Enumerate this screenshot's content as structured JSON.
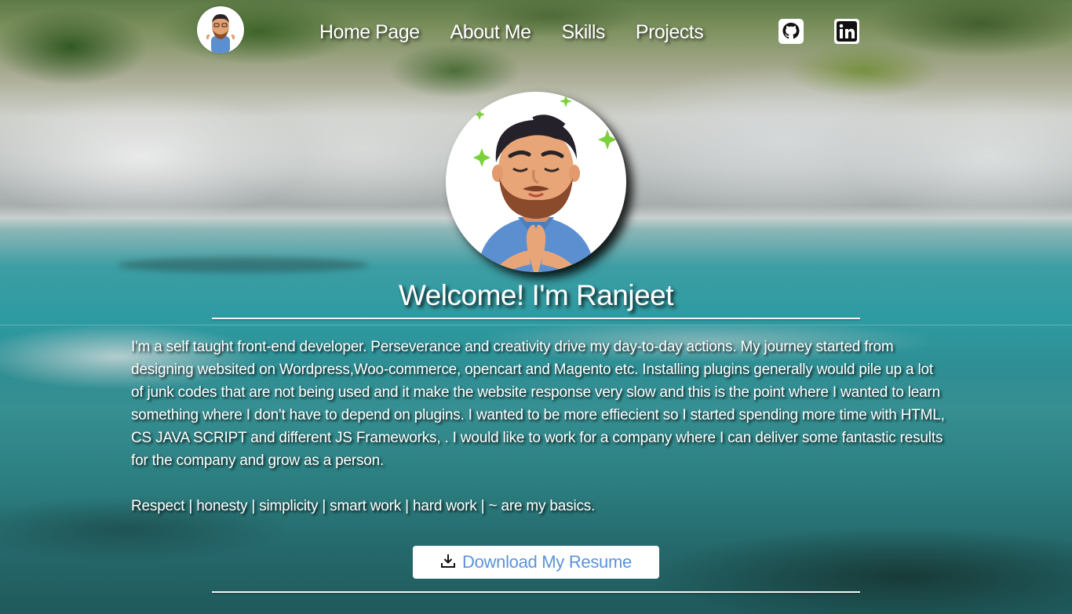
{
  "nav": {
    "logo_icon": "memoji-avatar-icon",
    "links": [
      "Home Page",
      "About Me",
      "Skills",
      "Projects"
    ],
    "social": [
      {
        "icon": "github-icon"
      },
      {
        "icon": "linkedin-icon"
      }
    ]
  },
  "hero": {
    "avatar_icon": "memoji-avatar-icon",
    "title": "Welcome! I'm Ranjeet",
    "bio": "I'm a self taught front-end developer. Perseverance and creativity drive my day-to-day actions. My journey started from designing websited on Wordpress,Woo-commerce, opencart and Magento etc. Installing plugins generally would pile up a lot of junk codes that are not being used and it make the website response very slow and this is the point where I wanted to learn something where I don't have to depend on plugins. I wanted to be more effiecient so I started spending more time with HTML, CS JAVA SCRIPT and different JS Frameworks, . I would like to work for a company where I can deliver some fantastic results for the company and grow as a person.",
    "values": "Respect | honesty | simplicity | smart work | hard work | ~ are my basics."
  },
  "resume_button": {
    "label": "Download My Resume",
    "icon": "download-icon"
  },
  "colors": {
    "text": "#ffffff",
    "button_text": "#5b93d9",
    "button_bg": "#ffffff"
  }
}
